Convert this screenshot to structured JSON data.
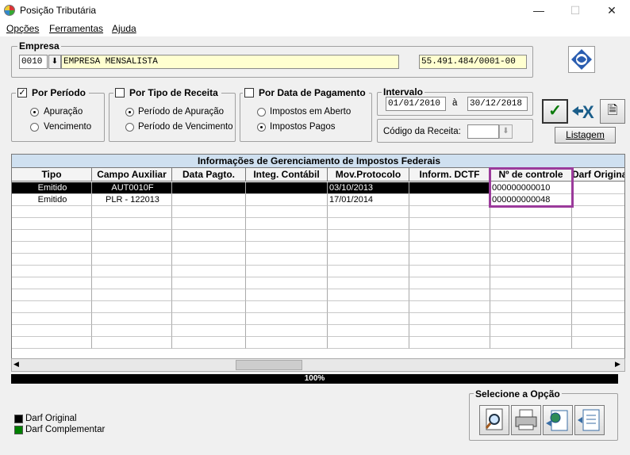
{
  "window": {
    "title": "Posição Tributária"
  },
  "menu": {
    "opcoes": "Opções",
    "ferramentas": "Ferramentas",
    "ajuda": "Ajuda"
  },
  "empresa": {
    "group_title": "Empresa",
    "code": "0010",
    "name": "EMPRESA MENSALISTA",
    "cnpj": "55.491.484/0001-00"
  },
  "por_periodo": {
    "title": "Por Período",
    "checked": true,
    "options": [
      "Apuração",
      "Vencimento"
    ],
    "selected": "Apuração"
  },
  "por_tipo": {
    "title": "Por Tipo de Receita",
    "checked": false,
    "options": [
      "Período de Apuração",
      "Período de Vencimento"
    ],
    "selected": "Período de Apuração"
  },
  "por_data": {
    "title": "Por Data de Pagamento",
    "checked": false,
    "options": [
      "Impostos em Aberto",
      "Impostos Pagos"
    ],
    "selected": "Impostos Pagos"
  },
  "intervalo": {
    "title": "Intervalo",
    "from": "01/01/2010",
    "sep": "à",
    "to": "30/12/2018"
  },
  "codigo_receita": {
    "label": "Código da Receita:",
    "value": ""
  },
  "buttons": {
    "listagem": "Listagem"
  },
  "grid": {
    "title": "Informações de Gerenciamento de Impostos Federais",
    "columns": [
      "Tipo",
      "Campo Auxiliar",
      "Data Pagto.",
      "Integ. Contábil",
      "Mov.Protocolo",
      "Inform. DCTF",
      "Nº de controle",
      "Darf Original"
    ],
    "rows": [
      [
        "Emitido",
        "AUT0010F",
        "",
        "",
        "03/10/2013",
        "",
        "000000000010",
        ""
      ],
      [
        "Emitido",
        "PLR - 122013",
        "",
        "",
        "17/01/2014",
        "",
        "000000000048",
        ""
      ]
    ],
    "selected_row": 0
  },
  "progress": {
    "value": "100%",
    "fraction": 1.0
  },
  "opcoes_group": {
    "title": "Selecione a Opção",
    "icons": [
      "preview-icon",
      "printer-icon",
      "export-web-icon",
      "document-icon"
    ]
  },
  "legend": [
    {
      "label": "Darf Original",
      "color": "#000000"
    },
    {
      "label": "Darf Complementar",
      "color": "#008000"
    }
  ],
  "colors": {
    "highlight": "#9b3b9b",
    "grid_title": "#cfe0f0"
  }
}
